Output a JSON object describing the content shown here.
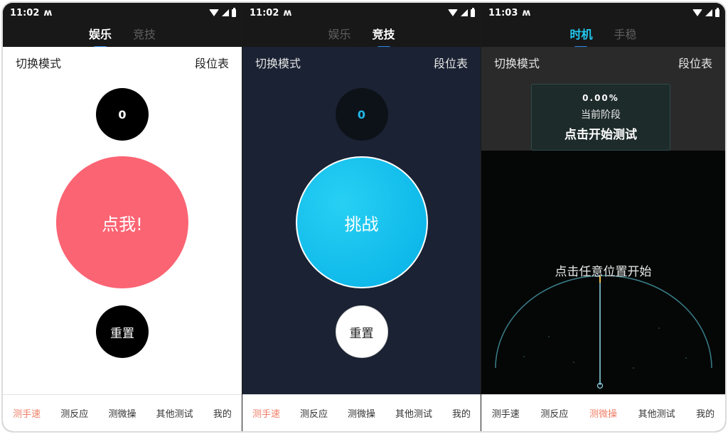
{
  "status": {
    "time_1": "11:02",
    "time_2": "11:02",
    "time_3": "11:03"
  },
  "panel1": {
    "tabs": [
      {
        "label": "娱乐"
      },
      {
        "label": "竞技"
      }
    ],
    "switch_mode": "切换模式",
    "rank_table": "段位表",
    "score": "0",
    "main_button": "点我!",
    "reset_button": "重置"
  },
  "panel2": {
    "tabs": [
      {
        "label": "娱乐"
      },
      {
        "label": "竞技"
      }
    ],
    "switch_mode": "切换模式",
    "rank_table": "段位表",
    "score": "0",
    "main_button": "挑战",
    "reset_button": "重置"
  },
  "panel3": {
    "tabs": [
      {
        "label": "时机"
      },
      {
        "label": "手稳"
      }
    ],
    "switch_mode": "切换模式",
    "rank_table": "段位表",
    "progress": "0.00%",
    "current_stage_label": "当前阶段",
    "start_prompt": "点击开始测试",
    "tap_anywhere": "点击任意位置开始"
  },
  "bottom_nav": [
    {
      "label": "测手速"
    },
    {
      "label": "测反应"
    },
    {
      "label": "测微操"
    },
    {
      "label": "其他测试"
    },
    {
      "label": "我的"
    }
  ],
  "colors": {
    "accent_pink": "#fb6473",
    "accent_cyan": "#06b0e6",
    "nav_active": "#f07f67",
    "tab_indicator": "#2f86e6"
  }
}
